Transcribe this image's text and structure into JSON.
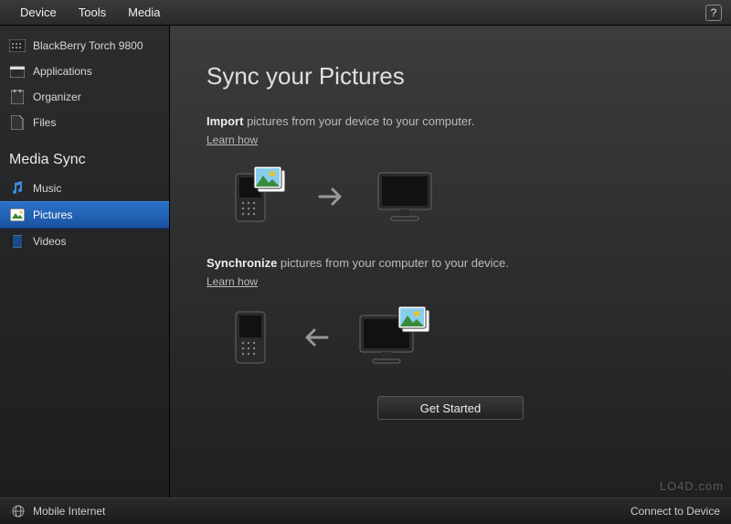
{
  "menubar": {
    "device": "Device",
    "tools": "Tools",
    "media": "Media",
    "help_tooltip": "?"
  },
  "sidebar": {
    "device_name": "BlackBerry Torch 9800",
    "items": [
      {
        "label": "Applications"
      },
      {
        "label": "Organizer"
      },
      {
        "label": "Files"
      }
    ],
    "section_title": "Media Sync",
    "media_items": [
      {
        "label": "Music"
      },
      {
        "label": "Pictures"
      },
      {
        "label": "Videos"
      }
    ],
    "selected": "Pictures"
  },
  "main": {
    "title": "Sync your Pictures",
    "import": {
      "bold": "Import",
      "rest": " pictures from your device to your computer.",
      "learn": "Learn how"
    },
    "sync": {
      "bold": "Synchronize",
      "rest": " pictures from your computer to your device.",
      "learn": "Learn how"
    },
    "get_started": "Get Started"
  },
  "footer": {
    "mobile_internet": "Mobile Internet",
    "connect": "Connect to Device"
  },
  "watermark": "LO4D.com"
}
